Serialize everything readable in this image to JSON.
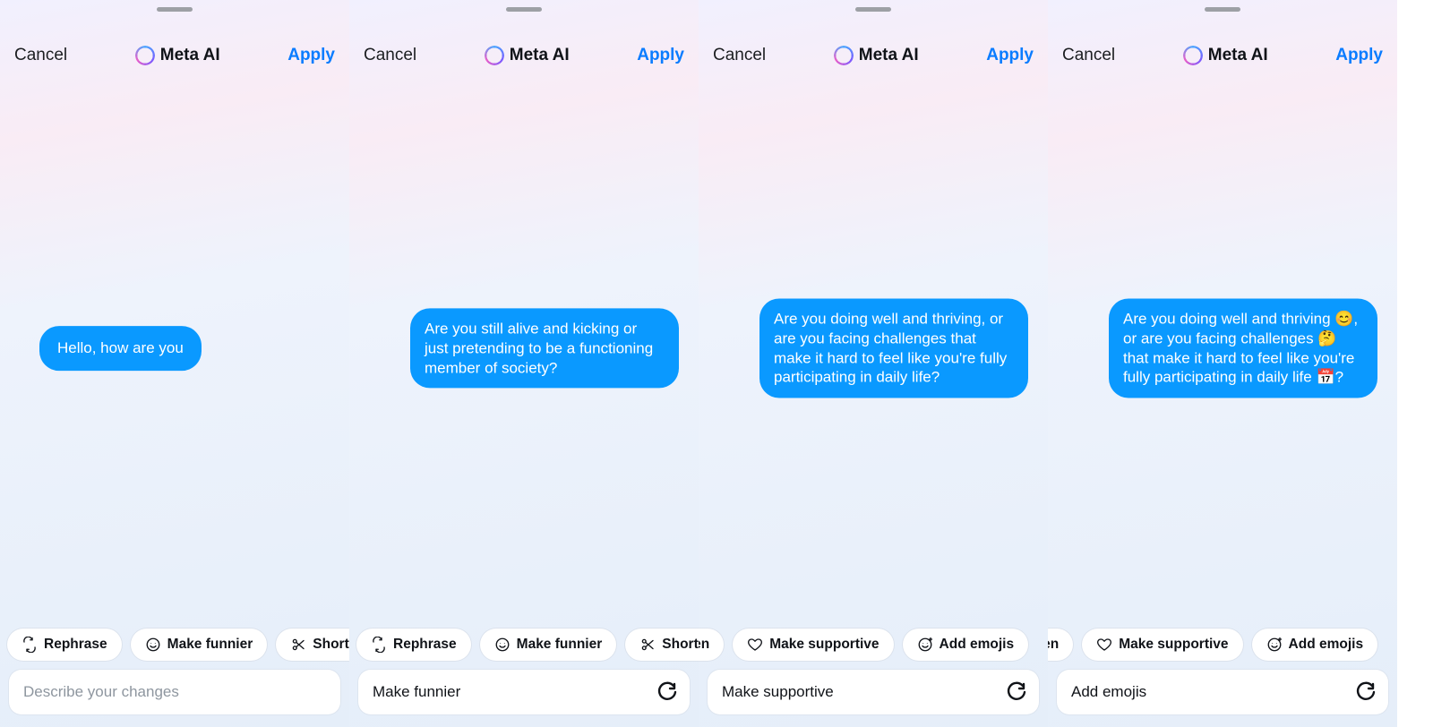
{
  "header": {
    "cancel_label": "Cancel",
    "brand_name": "Meta AI",
    "apply_label": "Apply"
  },
  "suggestions": {
    "rephrase": "Rephrase",
    "make_funnier": "Make funnier",
    "shorten": "Shorten",
    "make_supportive": "Make supportive",
    "add_emojis": "Add emojis",
    "horten_fragment": "horten"
  },
  "input": {
    "placeholder": "Describe your changes"
  },
  "panels": [
    {
      "align": "left",
      "message": "Hello, how are you",
      "chips": [
        "rephrase",
        "make_funnier",
        "shorten"
      ],
      "chips_offset": false,
      "input_value": "",
      "show_reload": false
    },
    {
      "align": "right",
      "message": "Are you still alive and kicking or just pretending to be a functioning member of society?",
      "chips": [
        "rephrase",
        "make_funnier",
        "shorten"
      ],
      "chips_offset": false,
      "input_value": "Make funnier",
      "show_reload": true
    },
    {
      "align": "right",
      "message": "Are you doing well and thriving, or are you facing challenges that make it hard to feel like you're fully participating in daily life?",
      "chips": [
        "horten_fragment",
        "make_supportive",
        "add_emojis"
      ],
      "chips_offset": true,
      "input_value": "Make supportive",
      "show_reload": true
    },
    {
      "align": "right",
      "message": "Are you doing well and thriving 😊, or are you facing challenges 🤔 that make it hard to feel like you're fully participating in daily life 📅?",
      "chips": [
        "horten_fragment",
        "make_supportive",
        "add_emojis"
      ],
      "chips_offset": true,
      "input_value": "Add emojis",
      "show_reload": true
    }
  ]
}
